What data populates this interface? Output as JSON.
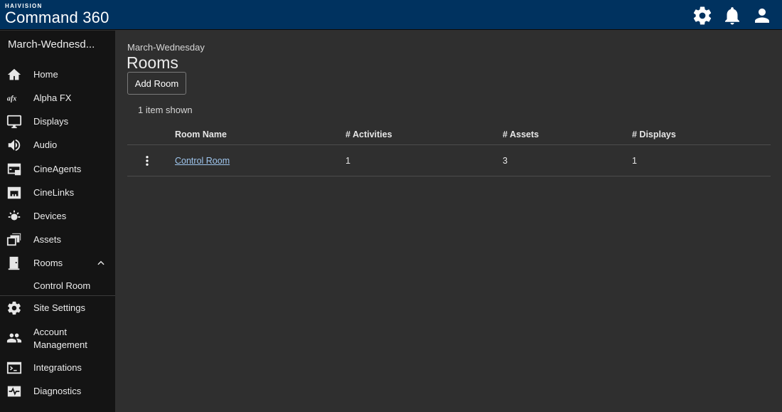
{
  "header": {
    "brand": "HAIVISION",
    "product": "Command 360",
    "icons": [
      "settings-icon",
      "bell-icon",
      "user-icon"
    ]
  },
  "sidebar": {
    "site_name": "March-Wednesd...",
    "items": [
      {
        "label": "Home",
        "icon": "home-icon"
      },
      {
        "label": "Alpha FX",
        "icon": "alpha-fx-icon",
        "icon_text": "afx"
      },
      {
        "label": "Displays",
        "icon": "monitor-icon"
      },
      {
        "label": "Audio",
        "icon": "speaker-icon"
      },
      {
        "label": "CineAgents",
        "icon": "cineagents-icon"
      },
      {
        "label": "CineLinks",
        "icon": "cinelinks-icon"
      },
      {
        "label": "Devices",
        "icon": "devices-icon"
      },
      {
        "label": "Assets",
        "icon": "assets-icon"
      },
      {
        "label": "Rooms",
        "icon": "door-icon",
        "expanded": true,
        "children": [
          {
            "label": "Control Room"
          }
        ]
      },
      {
        "label": "Site Settings",
        "icon": "gear-icon"
      },
      {
        "label": "Account Management",
        "icon": "people-icon"
      },
      {
        "label": "Integrations",
        "icon": "terminal-icon"
      },
      {
        "label": "Diagnostics",
        "icon": "pulse-icon"
      }
    ]
  },
  "main": {
    "breadcrumb": "March-Wednesday",
    "title": "Rooms",
    "add_button": "Add Room",
    "count_text": "1 item shown",
    "table": {
      "columns": [
        "Room Name",
        "# Activities",
        "# Assets",
        "# Displays"
      ],
      "rows": [
        {
          "name": "Control Room",
          "activities": "1",
          "assets": "3",
          "displays": "1"
        }
      ]
    }
  },
  "colors": {
    "header_bg": "#00325f",
    "sidebar_bg": "#141414",
    "content_bg": "#2f2f2f",
    "link": "#9fc6ee"
  }
}
